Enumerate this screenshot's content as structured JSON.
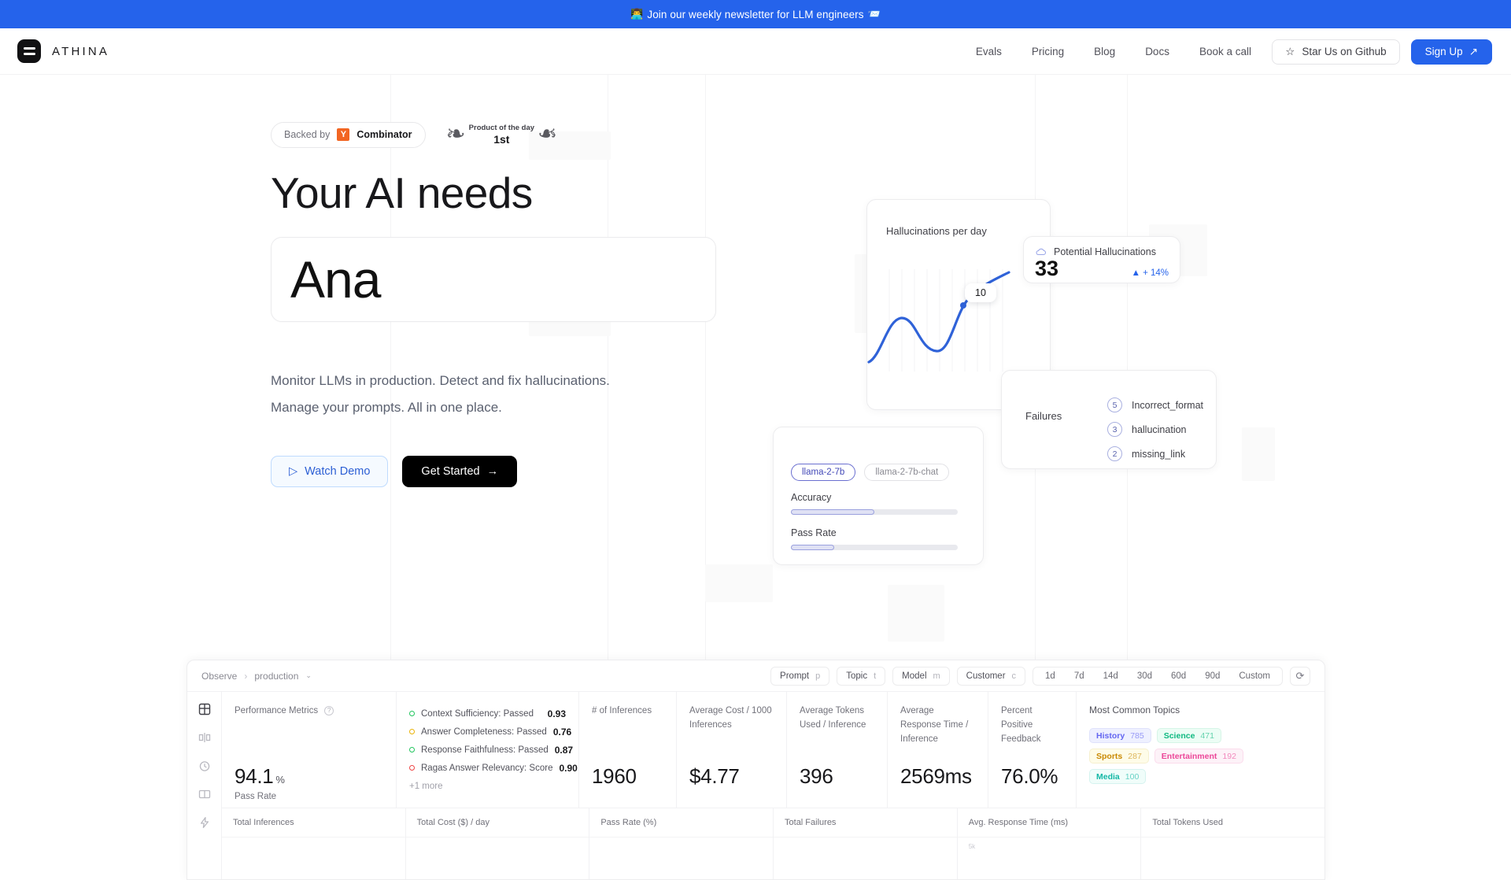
{
  "banner": {
    "emoji_left": "👨‍💻",
    "text": "Join our weekly newsletter for LLM engineers",
    "emoji_right": "📨"
  },
  "nav": {
    "brand": "ATHINA",
    "links": [
      "Evals",
      "Pricing",
      "Blog",
      "Docs",
      "Book a call"
    ],
    "github_label": "Star Us on Github",
    "signup_label": "Sign Up",
    "signup_icon": "↗"
  },
  "hero": {
    "badge_backed_prefix": "Backed by",
    "badge_yc_letter": "Y",
    "badge_yc_name": "Combinator",
    "badge_product_label": "Product of the day",
    "badge_product_rank": "1st",
    "headline": "Your AI needs",
    "typed_word": "Ana",
    "sub_line1": "Monitor LLMs in production. Detect and fix hallucinations.",
    "sub_line2": "Manage your prompts. All in one place.",
    "btn_demo": "Watch Demo",
    "btn_demo_icon": "▷",
    "btn_start": "Get Started",
    "btn_start_icon": "→"
  },
  "visuals": {
    "chart_card": {
      "title": "Hallucinations per day",
      "tooltip_value": "10"
    },
    "potential": {
      "icon": "cloud-icon",
      "label": "Potential Hallucinations",
      "value": "33",
      "delta_icon": "▲",
      "delta": "+ 14%"
    },
    "failures": {
      "label": "Failures",
      "items": [
        {
          "count": "5",
          "name": "Incorrect_format"
        },
        {
          "count": "3",
          "name": "hallucination"
        },
        {
          "count": "2",
          "name": "missing_link"
        }
      ]
    },
    "models": {
      "chip_active": "llama-2-7b",
      "chip_inactive": "llama-2-7b-chat",
      "metrics": [
        {
          "label": "Accuracy",
          "pct": 50
        },
        {
          "label": "Pass Rate",
          "pct": 26
        }
      ]
    }
  },
  "dashboard": {
    "breadcrumb": {
      "root": "Observe",
      "sep": "›",
      "current": "production",
      "chevron": "⌄"
    },
    "filters": [
      {
        "label": "Prompt",
        "key": "p"
      },
      {
        "label": "Topic",
        "key": "t"
      },
      {
        "label": "Model",
        "key": "m"
      },
      {
        "label": "Customer",
        "key": "c"
      }
    ],
    "ranges": [
      "1d",
      "7d",
      "14d",
      "30d",
      "60d",
      "90d",
      "Custom"
    ],
    "refresh_icon": "⟳",
    "rail_icons": [
      "grid-icon",
      "compare-icon",
      "history-icon",
      "columns-icon",
      "bolt-icon"
    ],
    "performance": {
      "label": "Performance Metrics",
      "value": "94.1",
      "unit": "%",
      "sub": "Pass Rate"
    },
    "checks": [
      {
        "name": "Context Sufficiency: Passed",
        "score": "0.93",
        "color": "#22c55e"
      },
      {
        "name": "Answer Completeness: Passed",
        "score": "0.76",
        "color": "#eab308"
      },
      {
        "name": "Response Faithfulness: Passed",
        "score": "0.87",
        "color": "#22c55e"
      },
      {
        "name": "Ragas Answer Relevancy: Score",
        "score": "0.90",
        "color": "#ef4444"
      }
    ],
    "checks_more": "+1 more",
    "kpis": [
      {
        "label": "# of Inferences",
        "value": "1960"
      },
      {
        "label": "Average Cost / 1000 Inferences",
        "value": "$4.77",
        "help": true
      },
      {
        "label": "Average Tokens Used / Inference",
        "value": "396"
      },
      {
        "label": "Average Response Time / Inference",
        "value": "2569ms"
      },
      {
        "label": "Percent Positive Feedback",
        "value": "76.0%",
        "help": true
      }
    ],
    "topics": {
      "label": "Most Common Topics",
      "items": [
        {
          "name": "History",
          "count": "785",
          "fg": "#6366f1",
          "bg": "#eef0ff",
          "bd": "#dfe2fb"
        },
        {
          "name": "Science",
          "count": "471",
          "fg": "#10b981",
          "bg": "#ecfdf5",
          "bd": "#d6f5e7"
        },
        {
          "name": "Sports",
          "count": "287",
          "fg": "#ca8a04",
          "bg": "#fefce8",
          "bd": "#f6f0cf"
        },
        {
          "name": "Entertainment",
          "count": "192",
          "fg": "#ec4899",
          "bg": "#fdf2f8",
          "bd": "#fbdcec"
        },
        {
          "name": "Media",
          "count": "100",
          "fg": "#14b8a6",
          "bg": "#f0fdfa",
          "bd": "#d5f3ef"
        }
      ]
    },
    "charts": [
      {
        "label": "Total Inferences"
      },
      {
        "label": "Total Cost ($) / day"
      },
      {
        "label": "Pass Rate (%)"
      },
      {
        "label": "Total Failures"
      },
      {
        "label": "Avg. Response Time (ms)"
      },
      {
        "label": "Total Tokens Used"
      }
    ]
  },
  "colors": {
    "brand_blue": "#2563eb",
    "banner_blue": "#2563eb",
    "black": "#000000"
  }
}
